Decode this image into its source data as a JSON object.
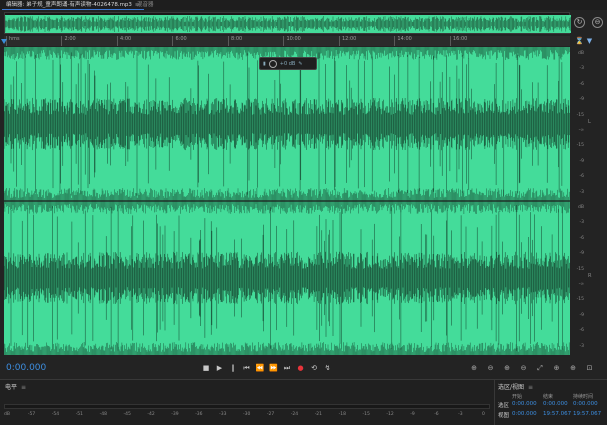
{
  "tabs": [
    {
      "label": "编辑器: 弟子规_童声朗诵-有声读物-4026478.mp3",
      "close": "≡"
    },
    {
      "label": "混音器"
    }
  ],
  "ruler_ticks": [
    "hms",
    "2:00",
    "4:00",
    "6:00",
    "8:00",
    "10:00",
    "12:00",
    "14:00",
    "16:00"
  ],
  "header_icons": [
    "hourglass-icon",
    "filter-icon"
  ],
  "hud": {
    "value": "+0 dB"
  },
  "db_scale": [
    "dB",
    "-3",
    "-6",
    "-9",
    "-15",
    "-∞",
    "-15",
    "-9",
    "-6",
    "-3",
    "dB",
    "-3",
    "-6",
    "-9",
    "-15",
    "-∞",
    "-15",
    "-9",
    "-6",
    "-3"
  ],
  "channels": [
    "L",
    "R"
  ],
  "transport": {
    "timecode": "0:00.000",
    "buttons": [
      {
        "name": "stop-button",
        "glyph": "■"
      },
      {
        "name": "play-button",
        "glyph": "▶"
      },
      {
        "name": "pause-button",
        "glyph": "‖"
      },
      {
        "name": "go-to-start-button",
        "glyph": "⏮"
      },
      {
        "name": "rewind-button",
        "glyph": "⏪"
      },
      {
        "name": "fast-forward-button",
        "glyph": "⏩"
      },
      {
        "name": "go-to-end-button",
        "glyph": "⏭"
      },
      {
        "name": "record-button",
        "glyph": "●"
      },
      {
        "name": "loop-button",
        "glyph": "⟲"
      },
      {
        "name": "skip-button",
        "glyph": "↯"
      }
    ],
    "zoom_buttons": [
      {
        "name": "zoom-in-amplitude-button",
        "glyph": "⊕"
      },
      {
        "name": "zoom-out-amplitude-button",
        "glyph": "⊖"
      },
      {
        "name": "zoom-in-time-button",
        "glyph": "⊕"
      },
      {
        "name": "zoom-out-time-button",
        "glyph": "⊖"
      },
      {
        "name": "zoom-full-button",
        "glyph": "⤢"
      },
      {
        "name": "zoom-in-left-button",
        "glyph": "⊕"
      },
      {
        "name": "zoom-in-right-button",
        "glyph": "⊕"
      },
      {
        "name": "zoom-selection-button",
        "glyph": "⊡"
      }
    ]
  },
  "levels_panel": {
    "title": "电平",
    "menu": "≡",
    "scale": [
      "dB",
      "-57",
      "-54",
      "-51",
      "-48",
      "-45",
      "-42",
      "-39",
      "-36",
      "-33",
      "-30",
      "-27",
      "-24",
      "-21",
      "-18",
      "-15",
      "-12",
      "-9",
      "-6",
      "-3",
      "0"
    ]
  },
  "selection_panel": {
    "title": "选区/视图",
    "menu": "≡",
    "headers": [
      "开始",
      "结束",
      "持续时间"
    ],
    "rows": [
      {
        "label": "选区",
        "start": "0:00.000",
        "end": "0:00.000",
        "duration": "0:00.000"
      },
      {
        "label": "视图",
        "start": "0:00.000",
        "end": "19:57.067",
        "duration": "19:57.067"
      }
    ]
  },
  "colors": {
    "waveform": "#44dc9a",
    "background": "#232323",
    "accent": "#3d8ee0",
    "record": "#e8343a"
  }
}
